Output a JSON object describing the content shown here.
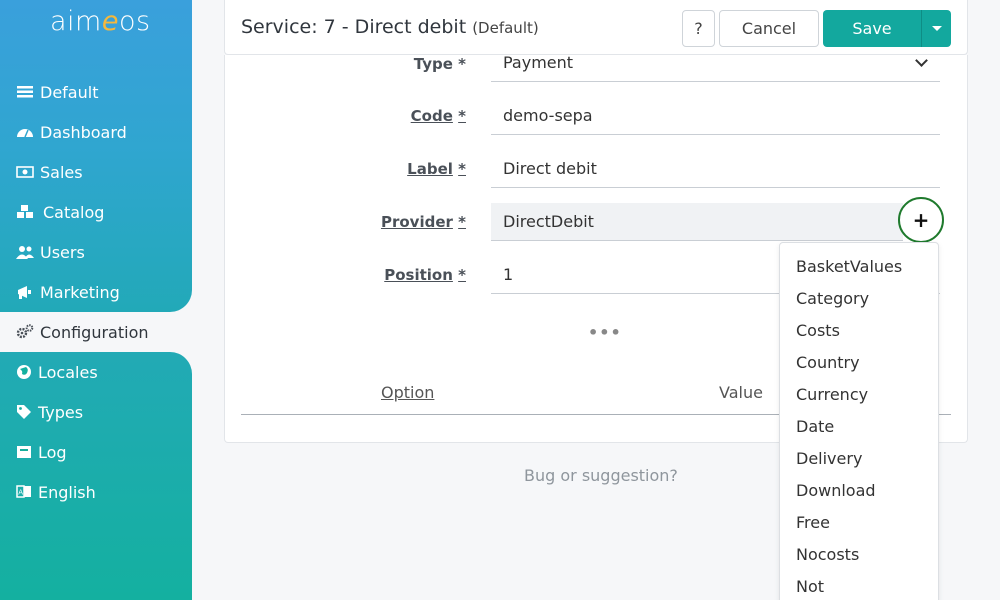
{
  "sidebar": {
    "logo": {
      "prefix": "aim",
      "accent": "e",
      "suffix": "os"
    },
    "items": [
      {
        "label": "Default",
        "icon": "list-icon"
      },
      {
        "label": "Dashboard",
        "icon": "dashboard-icon"
      },
      {
        "label": "Sales",
        "icon": "money-icon"
      },
      {
        "label": "Catalog",
        "icon": "cubes-icon"
      },
      {
        "label": "Users",
        "icon": "users-icon"
      },
      {
        "label": "Marketing",
        "icon": "bullhorn-icon"
      },
      {
        "label": "Configuration",
        "icon": "cogs-icon"
      },
      {
        "label": "Locales",
        "icon": "globe-icon"
      },
      {
        "label": "Types",
        "icon": "tag-icon"
      },
      {
        "label": "Log",
        "icon": "inbox-icon"
      },
      {
        "label": "English",
        "icon": "language-icon"
      }
    ]
  },
  "header": {
    "title": "Service: 7 - Direct debit",
    "subtitle": "(Default)",
    "help_label": "?",
    "cancel_label": "Cancel",
    "save_label": "Save"
  },
  "form": {
    "type": {
      "label": "Type",
      "required": "*",
      "value": "Payment"
    },
    "code": {
      "label": "Code",
      "required": "*",
      "value": "demo-sepa"
    },
    "label": {
      "label": "Label",
      "required": "*",
      "value": "Direct debit"
    },
    "provider": {
      "label": "Provider",
      "required": "*",
      "value": "DirectDebit",
      "add_label": "+"
    },
    "position": {
      "label": "Position",
      "required": "*",
      "value": "1"
    },
    "more_label": "•••"
  },
  "options_table": {
    "col_option": "Option",
    "col_value": "Value"
  },
  "footer": {
    "bug_label": "Bug or suggestion?"
  },
  "dropdown": {
    "items": [
      "BasketValues",
      "Category",
      "Costs",
      "Country",
      "Currency",
      "Date",
      "Delivery",
      "Download",
      "Free",
      "Nocosts",
      "Not"
    ]
  },
  "colors": {
    "accent": "#13a89e",
    "sidebar_top": "#3aa0dc",
    "sidebar_bottom": "#14b0a0",
    "logo_accent": "#f5b83c"
  }
}
